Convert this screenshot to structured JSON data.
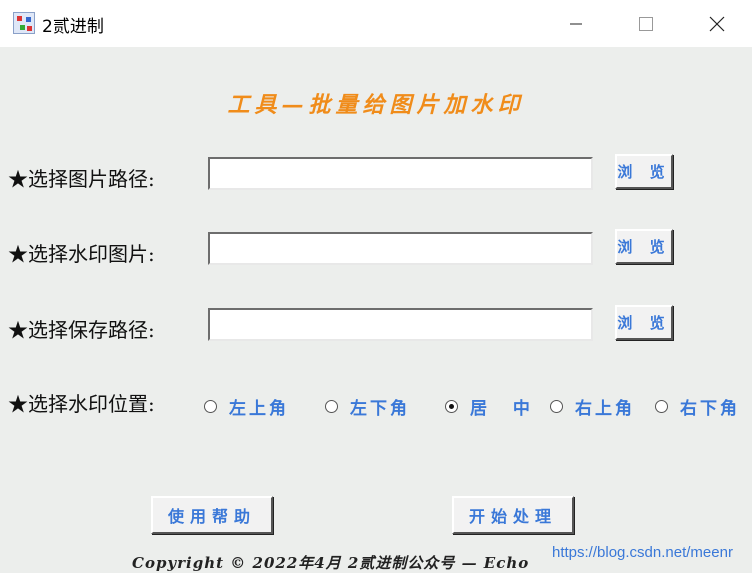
{
  "window": {
    "title": "2贰进制"
  },
  "heading": "工具—批量给图片加水印",
  "rows": [
    {
      "label": "★选择图片路径:",
      "value": "",
      "browse_label": "浏 览"
    },
    {
      "label": "★选择水印图片:",
      "value": "",
      "browse_label": "浏 览"
    },
    {
      "label": "★选择保存路径:",
      "value": "",
      "browse_label": "浏 览"
    }
  ],
  "position": {
    "label": "★选择水印位置:",
    "options": [
      "左上角",
      "左下角",
      "居 中",
      "右上角",
      "右下角"
    ],
    "selected": "居 中"
  },
  "buttons": {
    "help": "使用帮助",
    "start": "开始处理"
  },
  "footer": "Copyright © 2022年4月  2贰进制公众号 — Echo",
  "watermark": "https://blog.csdn.net/meenr",
  "colors": {
    "heading": "#f08c1a",
    "accent_text": "#3a78d8",
    "client_bg": "#eceeec"
  }
}
